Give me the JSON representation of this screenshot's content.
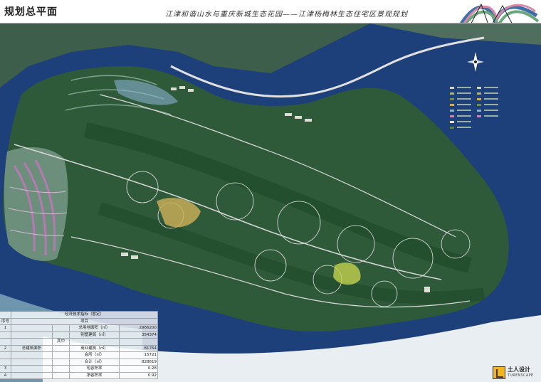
{
  "header": {
    "title": "规划总平面",
    "subtitle": "江津和谐山水与重庆新城生态花园——江津杨梅林生态住宅区景观规划",
    "colors": {
      "ribbon_blue": "#3e6fa8",
      "ribbon_green": "#6aa77b",
      "ribbon_pink": "#d98aa6"
    }
  },
  "map": {
    "compass_icon": "north-arrow-icon",
    "colors": {
      "water": "#1d3f7a",
      "land": "#2f5a3a",
      "forest": "#1e4a2a",
      "hill_contour": "#6b8f7a",
      "pink_zone": "#b57ab1",
      "road": "#d8d8d8",
      "riverbank": "#8fb3c7"
    }
  },
  "legend": {
    "items": [
      {
        "label": "",
        "color": "#cfd7c8"
      },
      {
        "label": "",
        "color": "#a5b68f"
      },
      {
        "label": "",
        "color": "#6a8c5a"
      },
      {
        "label": "",
        "color": "#d0b05a"
      },
      {
        "label": "",
        "color": "#8ab0d0"
      },
      {
        "label": "",
        "color": "#c38ab7"
      },
      {
        "label": "",
        "color": "#e6e6e6"
      },
      {
        "label": "",
        "color": "#5e7e4a"
      }
    ]
  },
  "table": {
    "caption": "经济技术指标（暂定）",
    "header": {
      "no": "序号",
      "item": "项目"
    },
    "rows": [
      {
        "no": "1",
        "name": "",
        "sub": "",
        "subname": "总用地面积（㎡）",
        "value": "2966200"
      },
      {
        "no": "",
        "name": "",
        "sub": "",
        "subname": "别墅建筑（㎡）",
        "value": "354374"
      },
      {
        "no": "",
        "name": "",
        "sub": "其中",
        "subname": "",
        "value": ""
      },
      {
        "no": "2",
        "name": "总建筑面积",
        "sub": "",
        "subname": "商业建筑（㎡）",
        "value": "81764"
      },
      {
        "no": "",
        "name": "",
        "sub": "",
        "subname": "会所（㎡）",
        "value": "15721"
      },
      {
        "no": "",
        "name": "",
        "sub": "",
        "subname": "合计（㎡）",
        "value": "828619"
      },
      {
        "no": "3",
        "name": "",
        "sub": "",
        "subname": "毛容积率",
        "value": "0.28"
      },
      {
        "no": "4",
        "name": "",
        "sub": "",
        "subname": "净容积率",
        "value": "0.92"
      }
    ]
  },
  "brand": {
    "cn": "土人设计",
    "en": "TURENSCAPE",
    "icon": "turenscape-logo-icon",
    "color": "#f2b51b"
  }
}
